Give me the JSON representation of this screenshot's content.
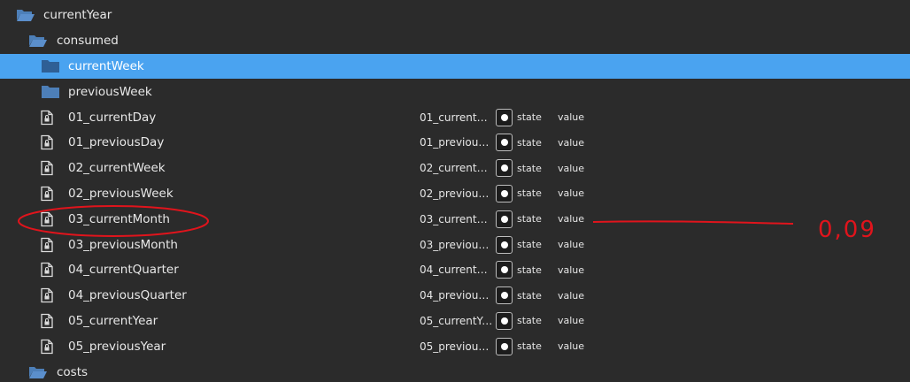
{
  "tree": {
    "current_year": "currentYear",
    "consumed": "consumed",
    "current_week": "currentWeek",
    "previous_week": "previousWeek",
    "costs": "costs",
    "states": [
      {
        "label": "01_currentDay",
        "name": "01_currentDay",
        "state": "state",
        "value": "value"
      },
      {
        "label": "01_previousDay",
        "name": "01_previousD...",
        "state": "state",
        "value": "value"
      },
      {
        "label": "02_currentWeek",
        "name": "02_currentW...",
        "state": "state",
        "value": "value"
      },
      {
        "label": "02_previousWeek",
        "name": "02_previous...",
        "state": "state",
        "value": "value"
      },
      {
        "label": "03_currentMonth",
        "name": "03_currentM...",
        "state": "state",
        "value": "value"
      },
      {
        "label": "03_previousMonth",
        "name": "03_previous...",
        "state": "state",
        "value": "value"
      },
      {
        "label": "04_currentQuarter",
        "name": "04_currentQu...",
        "state": "state",
        "value": "value"
      },
      {
        "label": "04_previousQuarter",
        "name": "04_previous...",
        "state": "state",
        "value": "value"
      },
      {
        "label": "05_currentYear",
        "name": "05_currentYear",
        "state": "state",
        "value": "value"
      },
      {
        "label": "05_previousYear",
        "name": "05_previousY...",
        "state": "state",
        "value": "value"
      }
    ]
  },
  "annotation": {
    "handwritten_value": "0,09",
    "color": "#e0141c"
  },
  "colors": {
    "background": "#2b2b2b",
    "selected_row": "#4aa3f0",
    "folder_icon": "#4d7fb8"
  }
}
